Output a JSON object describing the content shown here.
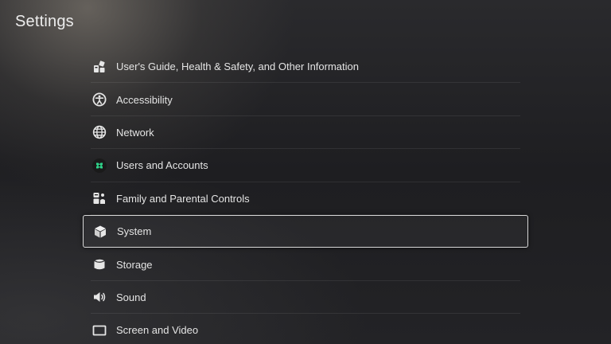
{
  "page": {
    "title": "Settings"
  },
  "menu": {
    "selected_index": 5,
    "items": [
      {
        "label": "User's Guide, Health & Safety, and Other Information",
        "icon": "guide-icon"
      },
      {
        "label": "Accessibility",
        "icon": "accessibility-icon"
      },
      {
        "label": "Network",
        "icon": "globe-icon"
      },
      {
        "label": "Users and Accounts",
        "icon": "users-accounts-icon"
      },
      {
        "label": "Family and Parental Controls",
        "icon": "family-controls-icon"
      },
      {
        "label": "System",
        "icon": "system-cube-icon"
      },
      {
        "label": "Storage",
        "icon": "storage-icon"
      },
      {
        "label": "Sound",
        "icon": "speaker-icon"
      },
      {
        "label": "Screen and Video",
        "icon": "screen-icon"
      }
    ]
  },
  "colors": {
    "users_accounts_icon_bg": "#1a1a1a",
    "users_accounts_icon_accent": "#2fd38a",
    "selection_border": "#d9d9d9"
  }
}
